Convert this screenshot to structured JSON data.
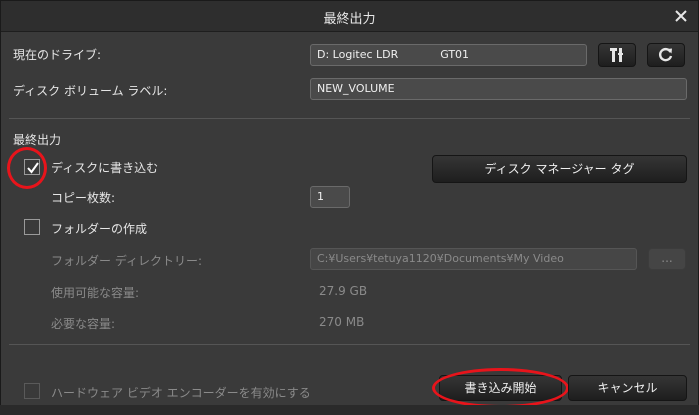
{
  "dialog": {
    "title": "最終出力"
  },
  "drive": {
    "label": "現在のドライブ:",
    "value": "D: Logitec LDR            GT01"
  },
  "volume": {
    "label": "ディスク ボリューム ラベル:",
    "value": "NEW_VOLUME"
  },
  "final_output": {
    "section_label": "最終出力",
    "burn_label": "ディスクに書き込む",
    "burn_checked": true,
    "disc_manager_label": "ディスク マネージャー タグ",
    "copies_label": "コピー枚数:",
    "copies_value": "1",
    "create_folder_label": "フォルダーの作成",
    "create_folder_checked": false,
    "folder_dir_label": "フォルダー ディレクトリー:",
    "folder_dir_value": "C:¥Users¥tetuya1120¥Documents¥My Video",
    "browse_label": "...",
    "available_label": "使用可能な容量:",
    "available_value": "27.9 GB",
    "required_label": "必要な容量:",
    "required_value": "270 MB"
  },
  "footer": {
    "hw_encoder_label": "ハードウェア ビデオ エンコーダーを有効にする",
    "start_label": "書き込み開始",
    "cancel_label": "キャンセル"
  }
}
